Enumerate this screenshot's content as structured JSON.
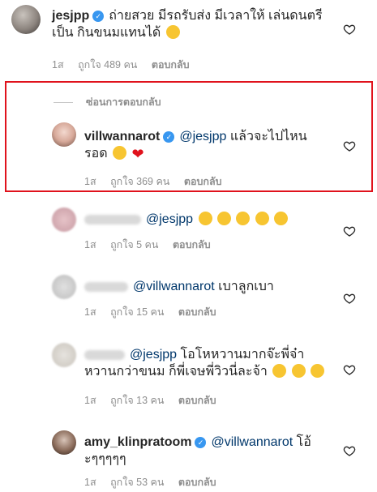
{
  "comments": [
    {
      "username": "jesjpp",
      "verified": true,
      "text": "ถ่ายสวย มีรถรับส่ง มีเวลาให้ เล่นดนตรีเป็น กินขนมแทนได้",
      "line1": "ถ่ายสวย มีรถรับส่ง มีเวลาให้ เล่นดนตรี",
      "line2": "เป็น กินขนมแทนได้",
      "time": "1ส",
      "likes": "ถูกใจ 489 คน",
      "reply": "ตอบกลับ"
    },
    {
      "username": "villwannarot",
      "verified": true,
      "mention": "@jesjpp",
      "line1": " แล้วจะไปไหน",
      "line2": "รอด",
      "time": "1ส",
      "likes": "ถูกใจ 369 คน",
      "reply": "ตอบกลับ"
    },
    {
      "mention": "@jesjpp",
      "text": "",
      "time": "1ส",
      "likes": "ถูกใจ 5 คน",
      "reply": "ตอบกลับ"
    },
    {
      "mention": "@villwannarot",
      "text": " เบาลูกเบา",
      "time": "1ส",
      "likes": "ถูกใจ 15 คน",
      "reply": "ตอบกลับ"
    },
    {
      "mention": "@jesjpp",
      "line1": " โอโหหวานมากจ๊ะพี่จ๋า",
      "line2": "หวานกว่าขนม ก็พี่เจษพี่วิวนี่ละจ้า",
      "time": "1ส",
      "likes": "ถูกใจ 13 คน",
      "reply": "ตอบกลับ"
    },
    {
      "username": "amy_klinpratoom",
      "verified": true,
      "mention": "@villwannarot",
      "line1": " โอ้",
      "line2": "ะๆๆๆๆๆ",
      "time": "1ส",
      "likes": "ถูกใจ 53 คน",
      "reply": "ตอบกลับ"
    }
  ],
  "hide_replies": "ซ่อนการตอบกลับ",
  "icons": {
    "like": "heart-outline-icon",
    "verified": "verified-badge-icon"
  },
  "colors": {
    "highlight_border": "#e0121c",
    "mention": "#00376b",
    "meta": "#8e8e8e",
    "verified": "#3897f0"
  }
}
